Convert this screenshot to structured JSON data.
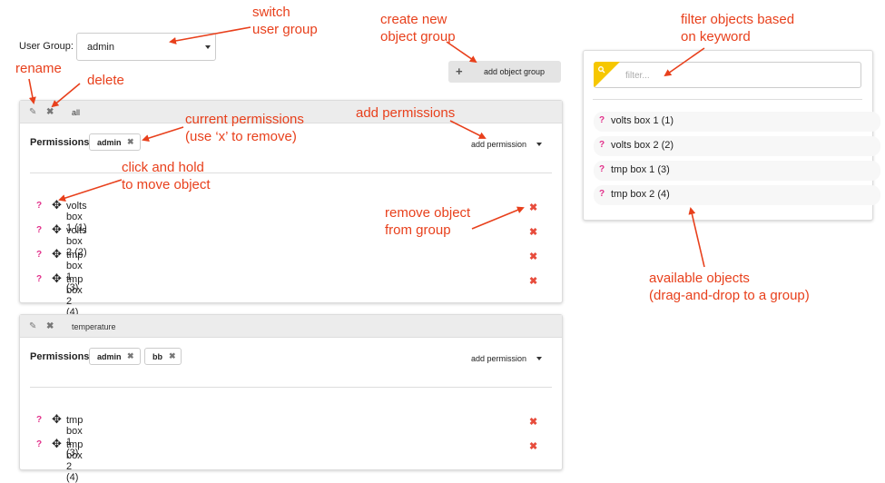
{
  "user_group": {
    "label": "User Group:",
    "value": "admin"
  },
  "toolbar": {
    "add_group_label": "add object group"
  },
  "groups": [
    {
      "name": "all",
      "permissions_label": "Permissions",
      "permissions": [
        "admin"
      ],
      "add_permission_label": "add permission",
      "objects": [
        "volts box 1 (1)",
        "volts box 2 (2)",
        "tmp box 1 (3)",
        "tmp box 2 (4)"
      ]
    },
    {
      "name": "temperature",
      "permissions_label": "Permissions",
      "permissions": [
        "admin",
        "bb"
      ],
      "add_permission_label": "add permission",
      "objects": [
        "tmp box 1 (3)",
        "tmp box 2 (4)"
      ]
    }
  ],
  "available": {
    "filter_placeholder": "filter...",
    "objects": [
      "volts box 1 (1)",
      "volts box 2 (2)",
      "tmp box 1 (3)",
      "tmp box 2 (4)"
    ]
  },
  "annotations": {
    "switch": [
      "switch",
      "user group"
    ],
    "create": [
      "create new",
      "object group"
    ],
    "filter": [
      "filter objects based",
      "on keyword"
    ],
    "rename": "rename",
    "delete": "delete",
    "current_permissions": [
      "current permissions",
      "(use ‘x’ to remove)"
    ],
    "add_permissions": "add permissions",
    "click_hold": [
      "click and hold",
      "to move object"
    ],
    "remove_object": [
      "remove object",
      "from group"
    ],
    "available": [
      "available objects",
      "(drag-and-drop to a group)"
    ]
  },
  "icons": {
    "edit": "edit-icon",
    "delete": "delete-icon",
    "question": "question-icon",
    "move": "move-icon",
    "remove": "remove-icon",
    "search": "search-icon",
    "plus": "plus-icon"
  },
  "colors": {
    "annotation": "#e8401c",
    "question": "#e2308a",
    "remove": "#e74c3c",
    "filter_badge": "#f6c700"
  }
}
